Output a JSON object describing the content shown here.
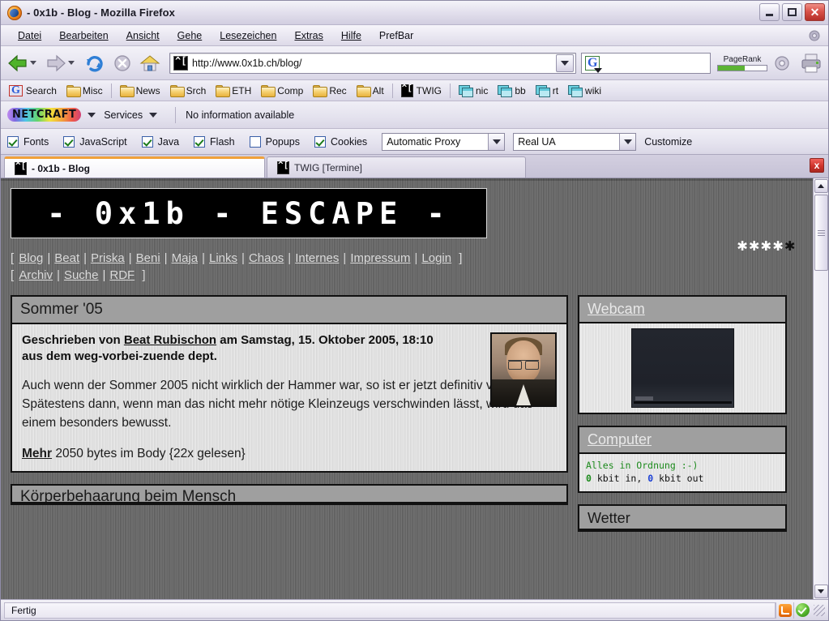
{
  "window": {
    "title": "- 0x1b - Blog - Mozilla Firefox",
    "minimize_label": "Minimize",
    "maximize_label": "Maximize",
    "close_label": "Close"
  },
  "menu": {
    "items": [
      "Datei",
      "Bearbeiten",
      "Ansicht",
      "Gehe",
      "Lesezeichen",
      "Extras",
      "Hilfe",
      "PrefBar"
    ]
  },
  "toolbar": {
    "back_label": "Back",
    "forward_label": "Forward",
    "reload_label": "Reload",
    "stop_label": "Stop",
    "home_label": "Home",
    "url": "http://www.0x1b.ch/blog/",
    "search_placeholder": "",
    "pagerank_label": "PageRank",
    "pagerank_percent": 55,
    "print_label": "Print"
  },
  "bookmarks": {
    "items": [
      {
        "label": "Search",
        "icon": "google-icon"
      },
      {
        "label": "Misc",
        "icon": "folder-icon"
      },
      {
        "label": "News",
        "icon": "folder-icon"
      },
      {
        "label": "Srch",
        "icon": "folder-icon"
      },
      {
        "label": "ETH",
        "icon": "folder-icon"
      },
      {
        "label": "Comp",
        "icon": "folder-icon"
      },
      {
        "label": "Rec",
        "icon": "folder-icon"
      },
      {
        "label": "Alt",
        "icon": "folder-icon"
      },
      {
        "label": "TWIG",
        "icon": "twig-icon"
      },
      {
        "label": "nic",
        "icon": "window-icon"
      },
      {
        "label": "bb",
        "icon": "window-icon"
      },
      {
        "label": "rt",
        "icon": "window-icon"
      },
      {
        "label": "wiki",
        "icon": "window-icon"
      }
    ]
  },
  "netcraft": {
    "logo": "NETCRAFT",
    "services_label": "Services",
    "info": "No information available"
  },
  "prefbar": {
    "checkboxes": [
      {
        "label": "Fonts",
        "checked": true
      },
      {
        "label": "JavaScript",
        "checked": true
      },
      {
        "label": "Java",
        "checked": true
      },
      {
        "label": "Flash",
        "checked": true
      },
      {
        "label": "Popups",
        "checked": false
      },
      {
        "label": "Cookies",
        "checked": true
      }
    ],
    "proxy_value": "Automatic Proxy",
    "useragent_value": "Real UA",
    "customize_label": "Customize"
  },
  "tabs": [
    {
      "label": "- 0x1b - Blog",
      "active": true
    },
    {
      "label": "TWIG [Termine]",
      "active": false
    }
  ],
  "tab_close_label": "x",
  "page": {
    "logo": "- 0x1b - ESCAPE -",
    "rating": {
      "filled": 4,
      "total": 5,
      "glyph": "*"
    },
    "nav_row1": [
      "Blog",
      "Beat",
      "Priska",
      "Beni",
      "Maja",
      "Links",
      "Chaos",
      "Internes",
      "Impressum",
      "Login"
    ],
    "nav_row2": [
      "Archiv",
      "Suche",
      "RDF"
    ],
    "nav_open": "[",
    "nav_close": "]",
    "nav_sep": "|",
    "article": {
      "title": "Sommer '05",
      "meta_prefix": "Geschrieben von ",
      "meta_author": "Beat Rubischon",
      "meta_suffix": " am Samstag, 15. Oktober 2005, 18:10",
      "dept": "aus dem weg-vorbei-zuende dept.",
      "body": "Auch wenn der Sommer 2005 nicht wirklich der Hammer war, so ist er jetzt definitiv vorbei. Spätestens dann, wenn man das nicht mehr nötige Kleinzeugs verschwinden lässt, wird das einem besonders bewusst.",
      "more_link": "Mehr",
      "more_text": " 2050 bytes im Body {22x gelesen}",
      "portrait_alt": "Beat Rubischon portrait"
    },
    "next_article_title": "Körperbehaarung beim Mensch",
    "sidebar": {
      "webcam": {
        "title": "Webcam",
        "image_alt": "webcam snapshot"
      },
      "computer": {
        "title": "Computer",
        "status": "Alles in Ordnung :-)",
        "in_value": "0",
        "in_label": " kbit in, ",
        "out_value": "0",
        "out_label": " kbit out"
      },
      "wetter": {
        "title": "Wetter"
      }
    }
  },
  "statusbar": {
    "text": "Fertig",
    "rss_label": "RSS feed available",
    "security_label": "Secure"
  },
  "colors": {
    "accent_tab": "#f0a13c",
    "page_bg": "#6b6b6b",
    "box_head": "#9f9f9f",
    "status_ok": "#1c8a1c",
    "link_blue": "#1a3fd4",
    "close_red": "#cf342c"
  }
}
